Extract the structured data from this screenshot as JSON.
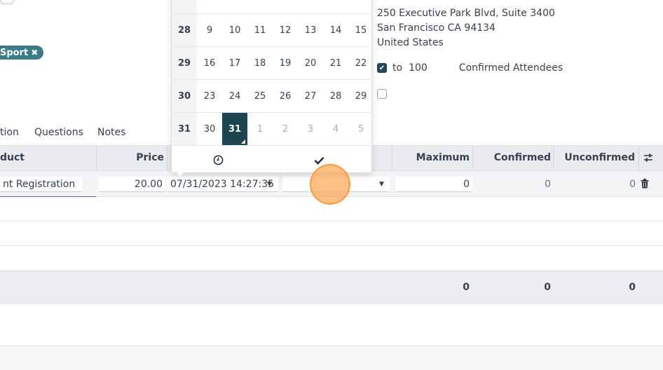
{
  "tag": {
    "label": "Sport",
    "remove_icon": "close-icon"
  },
  "address": {
    "line1": "250 Executive Park Blvd, Suite 3400",
    "line2": "San Francisco CA 94134",
    "line3": "United States"
  },
  "attendees": {
    "to_label": "to",
    "max": "100",
    "label": "Confirmed Attendees"
  },
  "tabs": [
    "tion",
    "Questions",
    "Notes"
  ],
  "table": {
    "headers": {
      "product": "duct",
      "price": "Price",
      "maximum": "Maximum",
      "confirmed": "Confirmed",
      "unconfirmed": "Unconfirmed"
    },
    "settings_icon": "sliders-icon",
    "edit_row": {
      "product": "nt Registration",
      "price": "20.00",
      "end_date": "07/31/2023 14:27:35",
      "sales_end": "",
      "maximum": "0",
      "confirmed": "0",
      "unconfirmed": "0",
      "delete_icon": "trash-icon"
    },
    "totals": {
      "maximum": "0",
      "confirmed": "0",
      "unconfirmed": "0"
    }
  },
  "datepicker": {
    "rows": [
      {
        "week": "28",
        "days": [
          "9",
          "10",
          "11",
          "12",
          "13",
          "14",
          "15"
        ]
      },
      {
        "week": "29",
        "days": [
          "16",
          "17",
          "18",
          "19",
          "20",
          "21",
          "22"
        ]
      },
      {
        "week": "30",
        "days": [
          "23",
          "24",
          "25",
          "26",
          "27",
          "28",
          "29"
        ]
      },
      {
        "week": "31",
        "days": [
          "30",
          "31",
          "1",
          "2",
          "3",
          "4",
          "5"
        ]
      }
    ],
    "selected_day": "31",
    "clock_icon": "clock-icon",
    "confirm_icon": "check-icon"
  },
  "colors": {
    "accent": "#1c4550",
    "tag": "#3b7a88",
    "click": "#fcaa5a"
  }
}
